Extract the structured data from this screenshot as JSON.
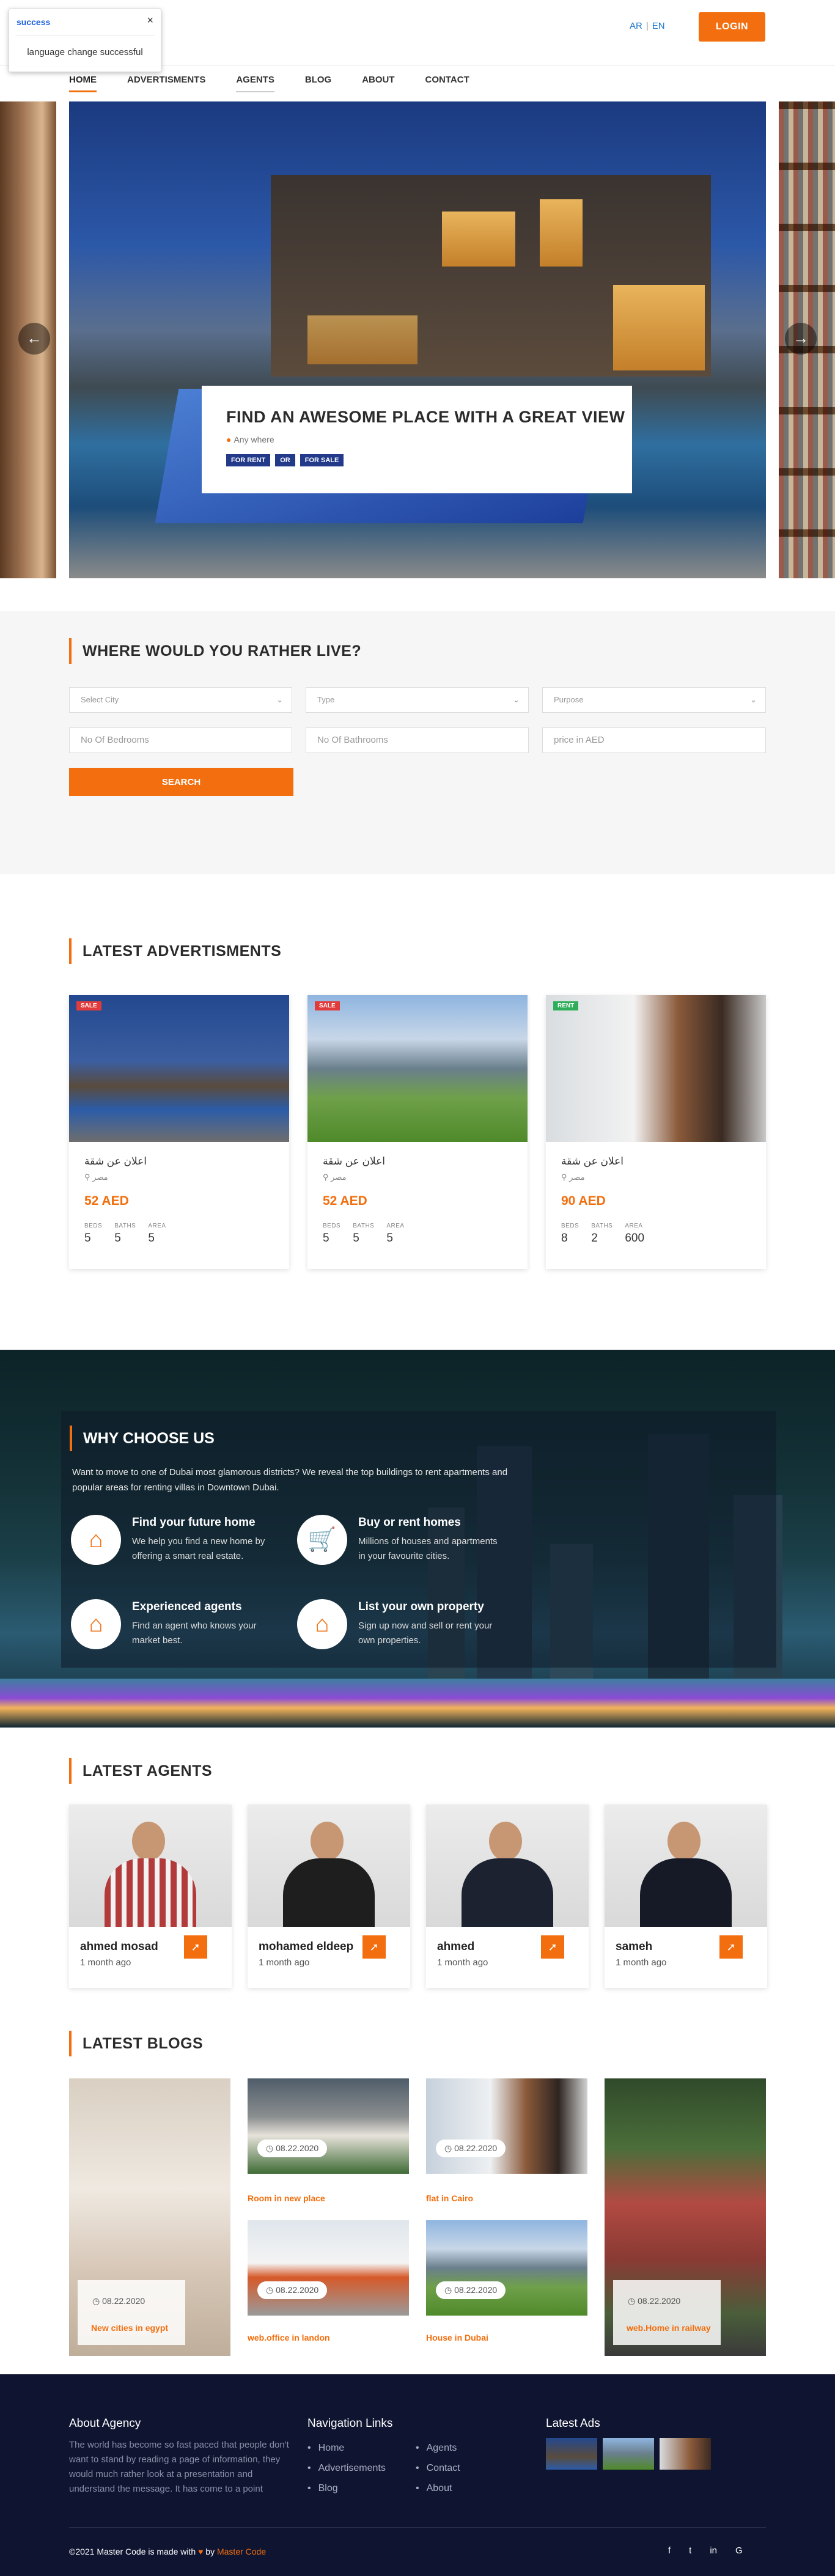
{
  "toast": {
    "title": "success",
    "close": "×",
    "message": "language change successful"
  },
  "header": {
    "lang_ar": "AR",
    "lang_sep": "|",
    "lang_en": "EN",
    "login": "LOGIN"
  },
  "nav": [
    "HOME",
    "ADVERTISMENTS",
    "AGENTS",
    "BLOG",
    "ABOUT",
    "CONTACT"
  ],
  "hero": {
    "title": "FIND AN AWESOME PLACE WITH A GREAT VIEW",
    "location": "Any where",
    "tags": [
      "FOR RENT",
      "OR",
      "FOR SALE"
    ],
    "prev": "←",
    "next": "→"
  },
  "search": {
    "title": "WHERE WOULD YOU RATHER LIVE?",
    "city_placeholder": "Select City",
    "type_placeholder": "Type",
    "purpose_placeholder": "Purpose",
    "bedrooms_placeholder": "No Of Bedrooms",
    "bathrooms_placeholder": "No Of Bathrooms",
    "price_placeholder": "price in AED",
    "button": "SEARCH"
  },
  "ads": {
    "title": "LATEST ADVERTISMENTS",
    "items": [
      {
        "badge": "SALE",
        "badge_color": "#e23b3b",
        "title": "اعلان عن شقة",
        "location": "مصر",
        "price": "52 AED",
        "beds": "5",
        "baths": "5",
        "area": "5"
      },
      {
        "badge": "SALE",
        "badge_color": "#e23b3b",
        "title": "اعلان عن شقة",
        "location": "مصر",
        "price": "52 AED",
        "beds": "5",
        "baths": "5",
        "area": "5"
      },
      {
        "badge": "RENT",
        "badge_color": "#2fae5a",
        "title": "اعلان عن شقة",
        "location": "مصر",
        "price": "90 AED",
        "beds": "8",
        "baths": "2",
        "area": "600"
      }
    ],
    "labels": {
      "beds": "BEDS",
      "baths": "BATHS",
      "area": "AREA"
    }
  },
  "why": {
    "title": "WHY CHOOSE US",
    "intro": "Want to move to one of Dubai most glamorous districts? We reveal the top buildings to rent apartments and popular areas for renting villas in Downtown Dubai.",
    "features": [
      {
        "title": "Find your future home",
        "text": "We help you find a new home by offering a smart real estate."
      },
      {
        "title": "Buy or rent homes",
        "text": "Millions of houses and apartments in your favourite cities."
      },
      {
        "title": "Experienced agents",
        "text": "Find an agent who knows your market best."
      },
      {
        "title": "List your own property",
        "text": "Sign up now and sell or rent your own properties."
      }
    ]
  },
  "agents": {
    "title": "LATEST AGENTS",
    "items": [
      {
        "name": "ahmed mosad",
        "time": "1 month ago"
      },
      {
        "name": "mohamed eldeep",
        "time": "1 month ago"
      },
      {
        "name": "ahmed",
        "time": "1 month ago"
      },
      {
        "name": "sameh",
        "time": "1 month ago"
      }
    ]
  },
  "blogs": {
    "title": "LATEST BLOGS",
    "items": [
      {
        "date": "08.22.2020",
        "title": "New cities in egypt"
      },
      {
        "date": "08.22.2020",
        "title": "Room in new place"
      },
      {
        "date": "08.22.2020",
        "title": "flat in Cairo"
      },
      {
        "date": "08.22.2020",
        "title": "web.office in landon"
      },
      {
        "date": "08.22.2020",
        "title": "House in Dubai"
      },
      {
        "date": "08.22.2020",
        "title": "web.Home in railway"
      }
    ]
  },
  "footer": {
    "about_title": "About Agency",
    "about_text": "The world has become so fast paced that people don't want to stand by reading a page of information, they would much rather look at a presentation and understand the message. It has come to a point",
    "nav_title": "Navigation Links",
    "links_left": [
      "Home",
      "Advertisements",
      "Blog"
    ],
    "links_right": [
      "Agents",
      "Contact",
      "About"
    ],
    "latest_ads_title": "Latest Ads",
    "copyright_pre": "©2021 Master Code is made with",
    "copyright_by": "by",
    "copyright_brand": "Master Code",
    "heart": "♥",
    "social": [
      "f",
      "t",
      "in",
      "G"
    ]
  },
  "colors": {
    "accent": "#f26e0e",
    "link": "#1c75c8",
    "footer_bg": "#0f1431",
    "tag_bg": "#233a8b"
  }
}
